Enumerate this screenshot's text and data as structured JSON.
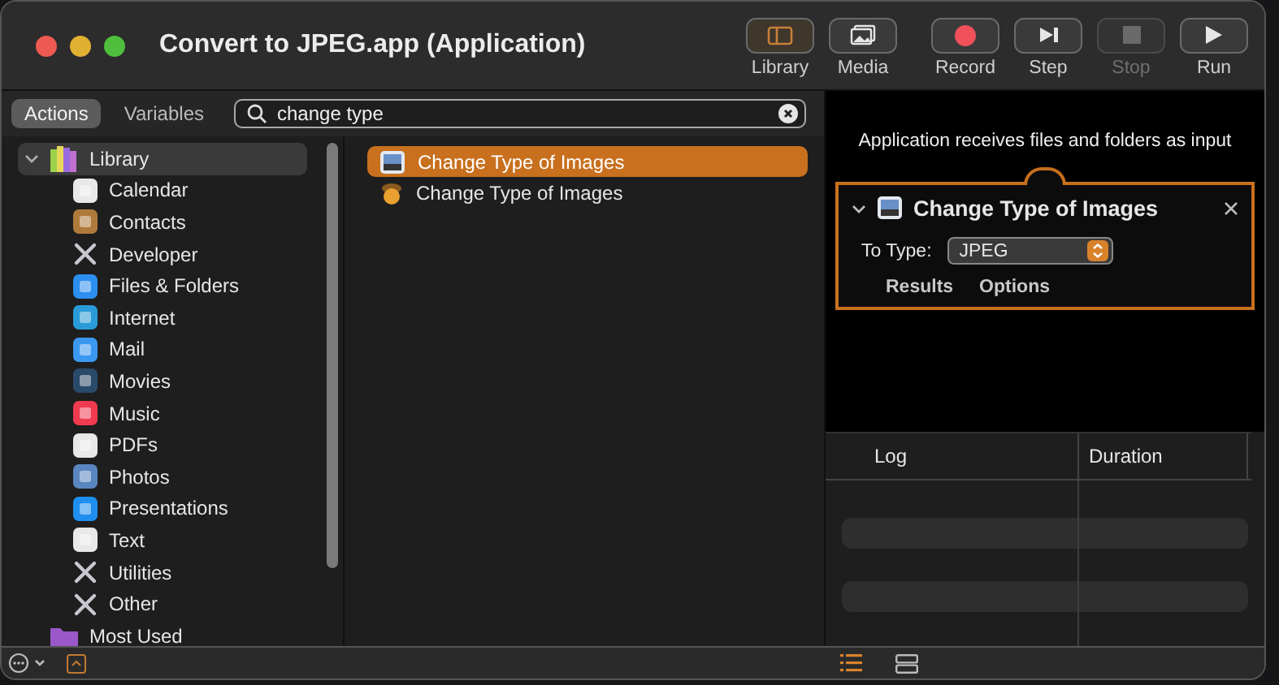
{
  "window": {
    "title": "Convert to JPEG.app (Application)"
  },
  "toolbar": [
    {
      "label": "Library",
      "disabled": false,
      "on": true
    },
    {
      "label": "Media",
      "disabled": false,
      "on": false
    },
    {
      "label": "Record",
      "disabled": false,
      "on": false
    },
    {
      "label": "Step",
      "disabled": false,
      "on": false
    },
    {
      "label": "Stop",
      "disabled": true,
      "on": false
    },
    {
      "label": "Run",
      "disabled": false,
      "on": false
    }
  ],
  "mode_tabs": [
    {
      "label": "Actions",
      "selected": true
    },
    {
      "label": "Variables",
      "selected": false
    }
  ],
  "search": {
    "value": "change type"
  },
  "library": [
    {
      "label": "Library",
      "selected": true,
      "expanded": true,
      "children": [
        {
          "label": "Calendar",
          "selected": false
        },
        {
          "label": "Contacts",
          "selected": false
        },
        {
          "label": "Developer",
          "selected": false
        },
        {
          "label": "Files & Folders",
          "selected": false
        },
        {
          "label": "Internet",
          "selected": false
        },
        {
          "label": "Mail",
          "selected": false
        },
        {
          "label": "Movies",
          "selected": false
        },
        {
          "label": "Music",
          "selected": false
        },
        {
          "label": "PDFs",
          "selected": false
        },
        {
          "label": "Photos",
          "selected": false
        },
        {
          "label": "Presentations",
          "selected": false
        },
        {
          "label": "Text",
          "selected": false
        },
        {
          "label": "Utilities",
          "selected": false
        },
        {
          "label": "Other",
          "selected": false
        }
      ]
    },
    {
      "label": "Most Used",
      "selected": false
    }
  ],
  "actions": [
    {
      "label": "Change Type of Images",
      "selected": true
    },
    {
      "label": "Change Type of Images",
      "selected": false
    }
  ],
  "workflow": {
    "input_note": "Application receives files and folders as input",
    "action": {
      "title": "Change Type of Images",
      "expanded": true,
      "field_label": "To Type:",
      "value": "JPEG",
      "tabs": [
        "Results",
        "Options"
      ]
    }
  },
  "log": {
    "columns": [
      "Log",
      "Duration"
    ]
  }
}
